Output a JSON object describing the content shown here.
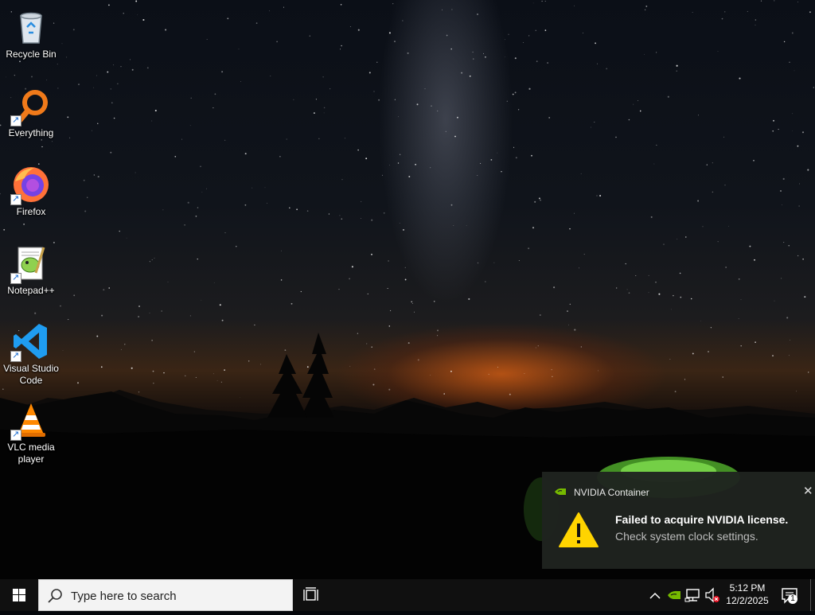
{
  "desktop": {
    "icons": [
      {
        "label": "Recycle Bin",
        "icon": "recycle-bin-icon"
      },
      {
        "label": "Everything",
        "icon": "everything-search-icon"
      },
      {
        "label": "Firefox",
        "icon": "firefox-icon"
      },
      {
        "label": "Notepad++",
        "icon": "notepadplusplus-icon"
      },
      {
        "label": "Visual Studio Code",
        "label_line1": "Visual Studio",
        "label_line2": "Code",
        "icon": "vscode-icon"
      },
      {
        "label": "VLC media player",
        "label_line1": "VLC media",
        "label_line2": "player",
        "icon": "vlc-icon"
      }
    ]
  },
  "toast": {
    "app_name": "NVIDIA Container",
    "title": "Failed to acquire NVIDIA license.",
    "message": "Check system clock settings.",
    "close_symbol": "✕",
    "icon": "warning-icon"
  },
  "taskbar": {
    "search_placeholder": "Type here to search",
    "clock_time": "5:12 PM",
    "clock_date": "12/2/2025",
    "notification_count": "1",
    "tray_icons": [
      "chevron-up-icon",
      "nvidia-tray-icon",
      "network-icon",
      "volume-muted-icon"
    ]
  },
  "colors": {
    "taskbar": "#101010",
    "toast_bg": "#1f231f",
    "nvidia_green": "#76b900",
    "warning_yellow": "#ffd400"
  }
}
